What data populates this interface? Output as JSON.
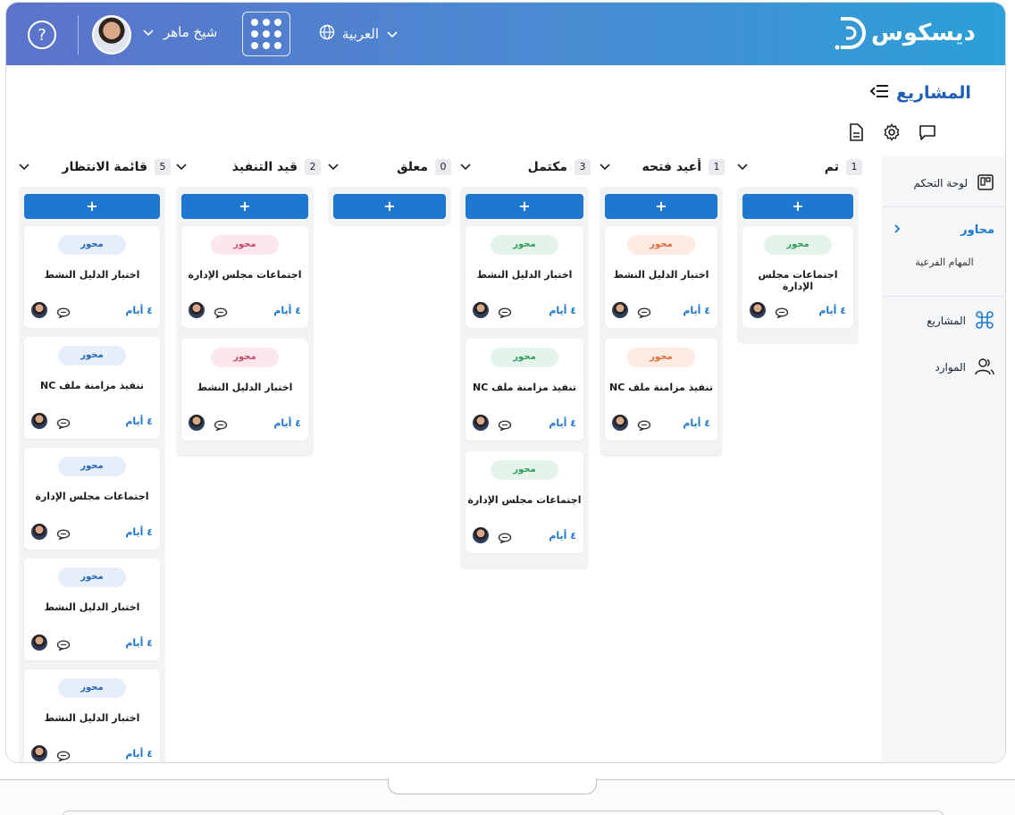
{
  "header": {
    "help_icon": "question-icon",
    "user_name": "شيخ ماهر",
    "language": "العربية",
    "logo_text": "ديسكوس"
  },
  "page": {
    "title": "المشاريع"
  },
  "sidebar": {
    "items": [
      {
        "label": "لوحة التحكم",
        "icon": "dashboard-icon"
      },
      {
        "label": "محاور",
        "icon": "chevron-left-icon"
      },
      {
        "label": "المهام الفرعية",
        "icon": ""
      },
      {
        "label": "المشاريع",
        "icon": "command-icon"
      },
      {
        "label": "الموارد",
        "icon": "users-icon"
      }
    ]
  },
  "board": {
    "add_label": "+",
    "columns": [
      {
        "title": "تم",
        "count": "1",
        "cards": [
          {
            "tag": "محور",
            "tag_color": "#2e9a57",
            "title": "اجتماعات مجلس الإدارة",
            "days": "٤ أيام"
          }
        ]
      },
      {
        "title": "أعيد فتحه",
        "count": "1",
        "cards": [
          {
            "tag": "محور",
            "tag_color": "#e1683a",
            "title": "اختبار الدليل النشط",
            "days": "٤ أيام"
          },
          {
            "tag": "محور",
            "tag_color": "#e1683a",
            "title": "تنفيذ مزامنة ملف NC",
            "days": "٤ أيام"
          }
        ]
      },
      {
        "title": "مكتمل",
        "count": "3",
        "cards": [
          {
            "tag": "محور",
            "tag_color": "#2e9a57",
            "title": "اختبار الدليل النشط",
            "days": "٤ أيام"
          },
          {
            "tag": "محور",
            "tag_color": "#2e9a57",
            "title": "تنفيذ مزامنة ملف NC",
            "days": "٤ أيام"
          },
          {
            "tag": "محور",
            "tag_color": "#2e9a57",
            "title": "اجتماعات مجلس الإدارة",
            "days": "٤ أيام"
          }
        ]
      },
      {
        "title": "معلق",
        "count": "0",
        "cards": []
      },
      {
        "title": "قيد التنفيذ",
        "count": "2",
        "cards": [
          {
            "tag": "محور",
            "tag_color": "#c9486a",
            "title": "اجتماعات مجلس الإدارة",
            "days": "٤ أيام"
          },
          {
            "tag": "محور",
            "tag_color": "#c9486a",
            "title": "اختبار الدليل النشط",
            "days": "٤ أيام"
          }
        ]
      },
      {
        "title": "قائمة الانتظار",
        "count": "5",
        "cards": [
          {
            "tag": "محور",
            "tag_color": "#2464b4",
            "title": "اختبار الدليل النشط",
            "days": "٤ أيام"
          },
          {
            "tag": "محور",
            "tag_color": "#2464b4",
            "title": "تنفيذ مزامنة ملف NC",
            "days": "٤ أيام"
          },
          {
            "tag": "محور",
            "tag_color": "#2464b4",
            "title": "اجتماعات مجلس الإدارة",
            "days": "٤ أيام"
          },
          {
            "tag": "محور",
            "tag_color": "#2464b4",
            "title": "اختبار الدليل النشط",
            "days": "٤ أيام"
          },
          {
            "tag": "محور",
            "tag_color": "#2464b4",
            "title": "اختبار الدليل النشط",
            "days": "٤ أيام"
          }
        ]
      }
    ]
  }
}
